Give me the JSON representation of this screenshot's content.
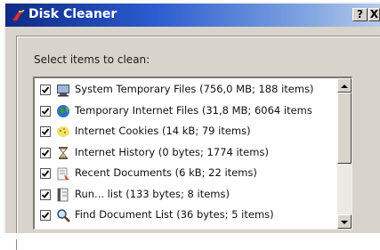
{
  "window": {
    "title": "Disk Cleaner",
    "help_label": "?",
    "close_label": "X"
  },
  "section": {
    "label": "Select items to clean:"
  },
  "items": [
    {
      "label": "System Temporary Files (756,0 MB; 188 items)",
      "checked": true,
      "icon": "system-temp-folder-icon"
    },
    {
      "label": "Temporary Internet Files (31,8 MB; 6064 items",
      "checked": true,
      "icon": "internet-globe-icon"
    },
    {
      "label": "Internet Cookies (14 kB; 79 items)",
      "checked": true,
      "icon": "cookie-icon"
    },
    {
      "label": "Internet History (0 bytes; 1774 items)",
      "checked": true,
      "icon": "hourglass-icon"
    },
    {
      "label": "Recent Documents (6 kB; 22 items)",
      "checked": true,
      "icon": "recent-documents-icon"
    },
    {
      "label": "Run... list (133 bytes; 8 items)",
      "checked": true,
      "icon": "run-list-icon"
    },
    {
      "label": "Find Document List (36 bytes; 5 items)",
      "checked": true,
      "icon": "magnifier-icon"
    }
  ],
  "colors": {
    "titlebar_start": "#0f2a86",
    "titlebar_end": "#b6cbe9",
    "window_bg": "#d8d4cb"
  }
}
